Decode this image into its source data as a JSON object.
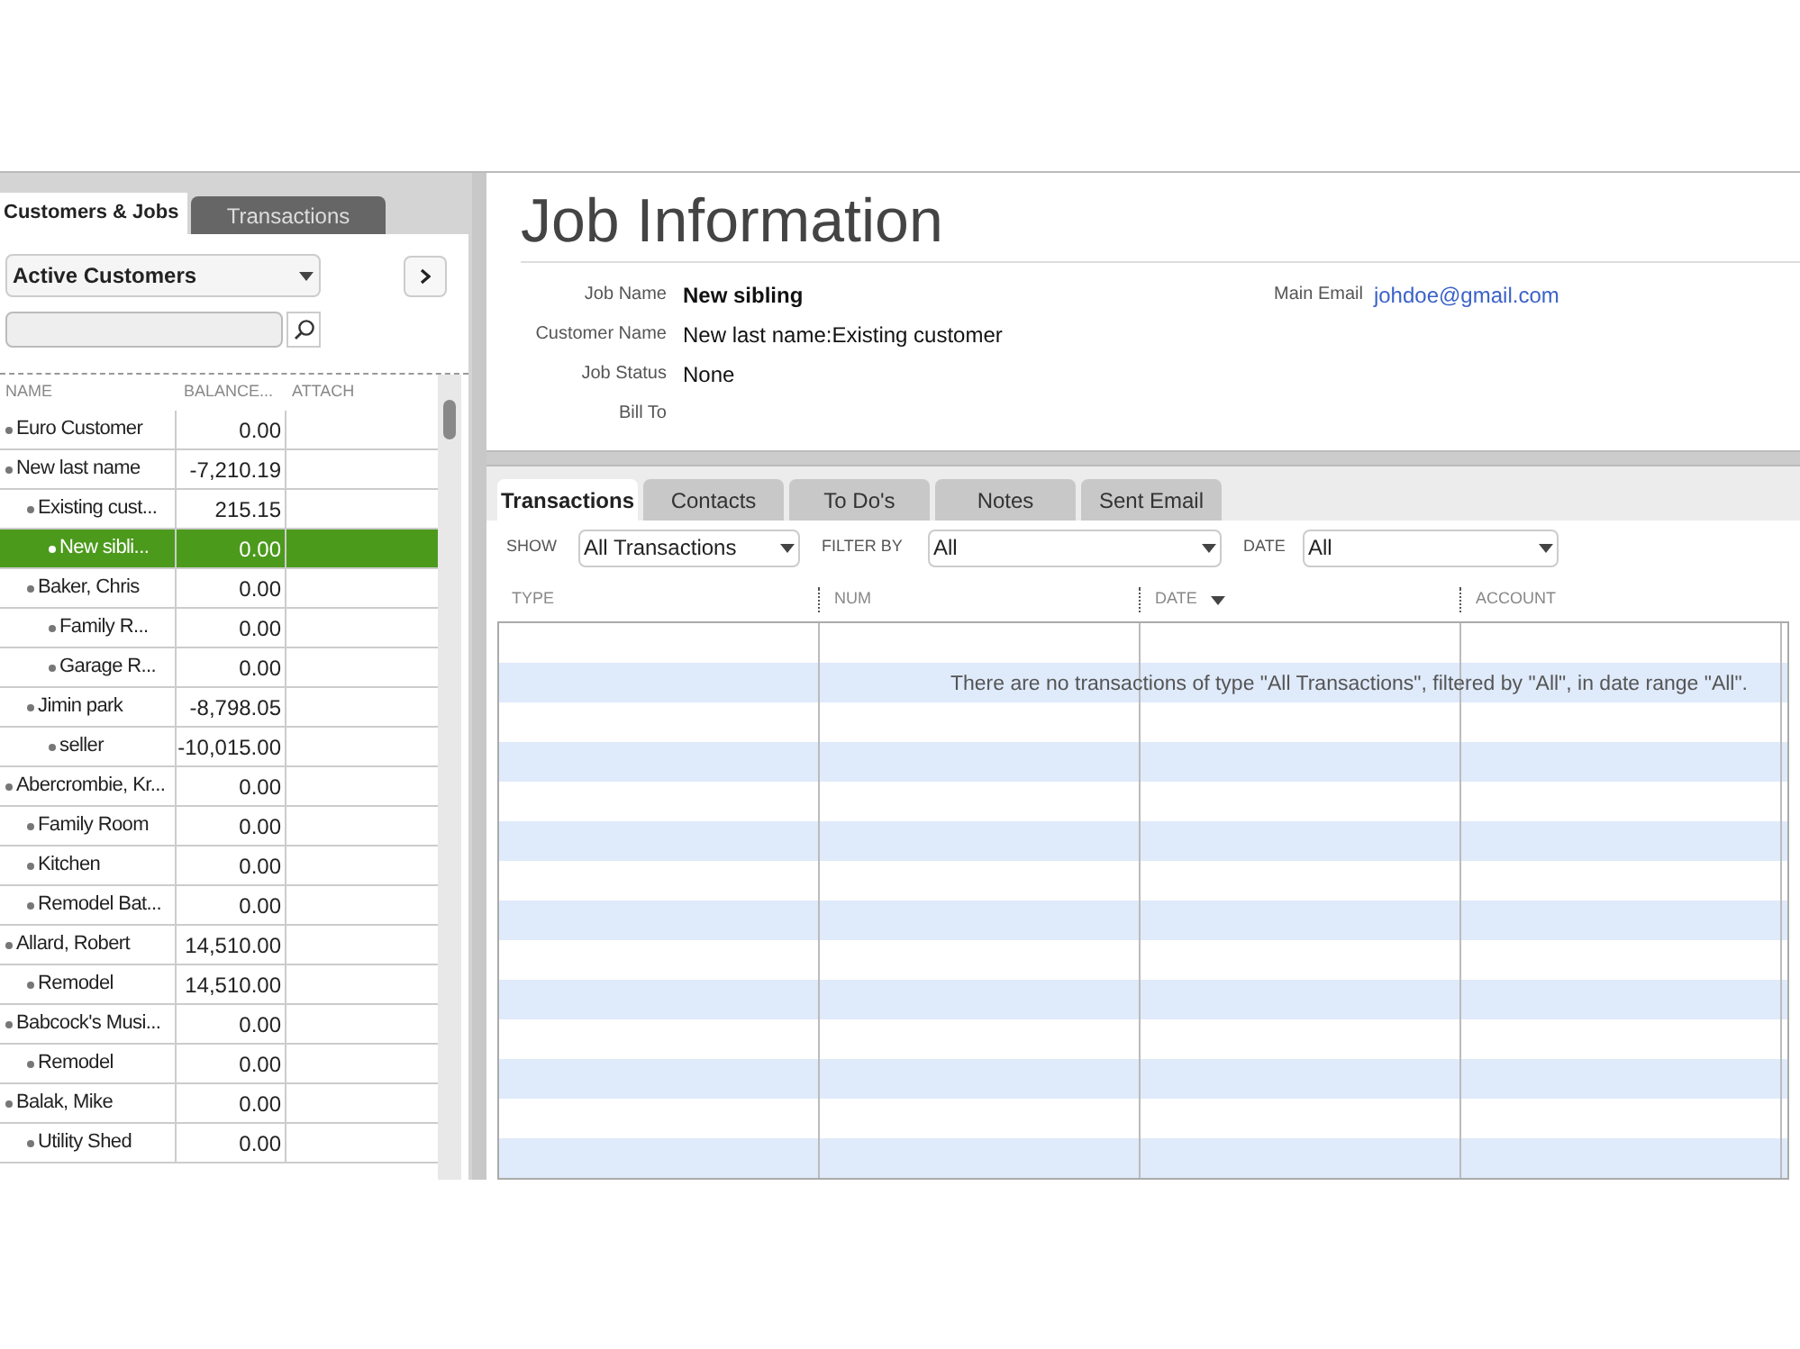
{
  "left_tabs": [
    {
      "label": "Customers & Jobs",
      "selected": true
    },
    {
      "label": "Transactions",
      "selected": false
    }
  ],
  "view_select": {
    "value": "Active Customers"
  },
  "customer_columns": [
    "NAME",
    "BALANCE...",
    "ATTACH"
  ],
  "customers": [
    {
      "name": "Euro Customer",
      "balance": "0.00",
      "selected": false
    },
    {
      "name": "New last name",
      "balance": "-7,210.19",
      "selected": false,
      "children": [
        {
          "name": "Existing cust...",
          "balance": "215.15",
          "selected": false,
          "children": [
            {
              "name": "New sibli...",
              "balance": "0.00",
              "selected": true
            }
          ]
        },
        {
          "name": "Baker, Chris",
          "balance": "0.00",
          "selected": false,
          "children": [
            {
              "name": "Family R...",
              "balance": "0.00",
              "selected": false
            },
            {
              "name": "Garage R...",
              "balance": "0.00",
              "selected": false
            }
          ]
        },
        {
          "name": "Jimin park",
          "balance": "-8,798.05",
          "selected": false,
          "children": [
            {
              "name": "seller",
              "balance": "-10,015.00",
              "selected": false
            }
          ]
        }
      ]
    },
    {
      "name": "Abercrombie, Kr...",
      "balance": "0.00",
      "selected": false,
      "children": [
        {
          "name": "Family Room",
          "balance": "0.00",
          "selected": false
        },
        {
          "name": "Kitchen",
          "balance": "0.00",
          "selected": false
        },
        {
          "name": "Remodel Bat...",
          "balance": "0.00",
          "selected": false
        }
      ]
    },
    {
      "name": "Allard, Robert",
      "balance": "14,510.00",
      "selected": false,
      "children": [
        {
          "name": "Remodel",
          "balance": "14,510.00",
          "selected": false
        }
      ]
    },
    {
      "name": "Babcock's Musi...",
      "balance": "0.00",
      "selected": false,
      "children": [
        {
          "name": "Remodel",
          "balance": "0.00",
          "selected": false
        }
      ]
    },
    {
      "name": "Balak, Mike",
      "balance": "0.00",
      "selected": false,
      "children": [
        {
          "name": "Utility Shed",
          "balance": "0.00",
          "selected": false
        }
      ]
    }
  ],
  "title": "Job Information",
  "fields": [
    {
      "label": "Job Name",
      "value": "New sibling",
      "kind": "bold"
    },
    {
      "label": "Customer Name",
      "value": "New last name:Existing customer",
      "kind": "plain"
    },
    {
      "label": "Job Status",
      "value": "None",
      "kind": "plain"
    },
    {
      "label": "Bill To"
    }
  ],
  "email": {
    "label": "Main Email",
    "value": "johdoe@gmail.com"
  },
  "detail_tabs": [
    {
      "label": "Transactions",
      "selected": true
    },
    {
      "label": "Contacts",
      "selected": false
    },
    {
      "label": "To Do's",
      "selected": false
    },
    {
      "label": "Notes",
      "selected": false
    },
    {
      "label": "Sent Email",
      "selected": false
    }
  ],
  "filters": [
    {
      "label": "SHOW",
      "value": "All Transactions"
    },
    {
      "label": "FILTER BY",
      "value": "All"
    },
    {
      "label": "DATE",
      "value": "All"
    }
  ],
  "transaction_columns": [
    "TYPE",
    "NUM",
    "DATE",
    "ACCOUNT"
  ],
  "empty_message": "There are no transactions of type \"All Transactions\", filtered by \"All\", in date range \"All\"."
}
